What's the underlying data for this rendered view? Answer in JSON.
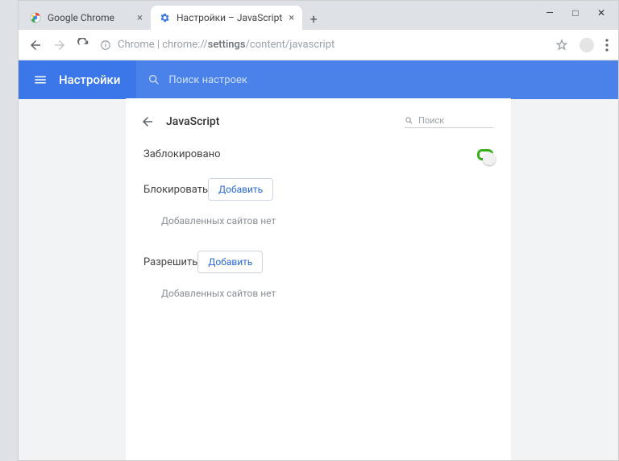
{
  "window_controls": {
    "min": "—",
    "max": "□",
    "close": "✕"
  },
  "tabs": [
    {
      "title": "Google Chrome",
      "active": false,
      "favicon": "chrome"
    },
    {
      "title": "Настройки – JavaScript",
      "active": true,
      "favicon": "gear"
    }
  ],
  "toolbar": {
    "secure_label": "Chrome",
    "url_prefix": "chrome://",
    "url_bold": "settings",
    "url_rest": "/content/javascript"
  },
  "bluebar": {
    "title": "Настройки",
    "search_placeholder": "Поиск настроек"
  },
  "page": {
    "title": "JavaScript",
    "search_placeholder": "Поиск",
    "blocked_label": "Заблокировано",
    "block_section": "Блокировать",
    "allow_section": "Разрешить",
    "add_label": "Добавить",
    "empty_text": "Добавленных сайтов нет"
  }
}
